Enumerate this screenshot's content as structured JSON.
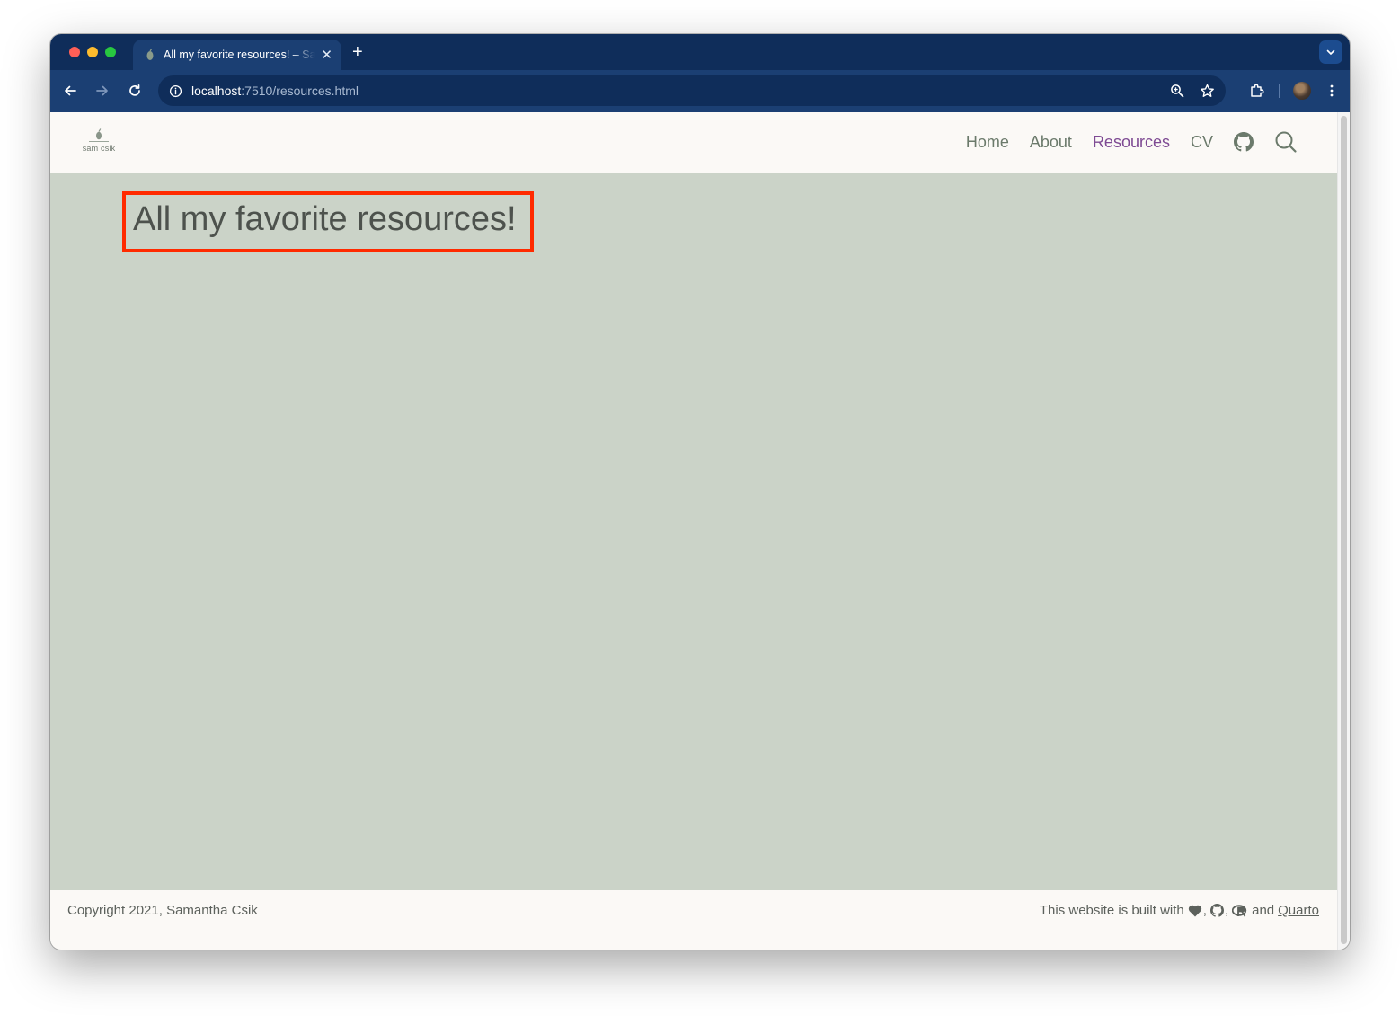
{
  "browser": {
    "tab_title": "All my favorite resources! – Sam Csik",
    "url_host": "localhost",
    "url_rest": ":7510/resources.html"
  },
  "site": {
    "logo_text": "sam csik",
    "nav": {
      "home": "Home",
      "about": "About",
      "resources": "Resources",
      "cv": "CV"
    },
    "active_color": "#7e4a93"
  },
  "main": {
    "title": "All my favorite resources!"
  },
  "footer": {
    "copyright": "Copyright 2021, Samantha Csik",
    "built_prefix": "This website is built with",
    "comma1": ",",
    "comma2": ",",
    "and": "and",
    "quarto": "Quarto"
  }
}
